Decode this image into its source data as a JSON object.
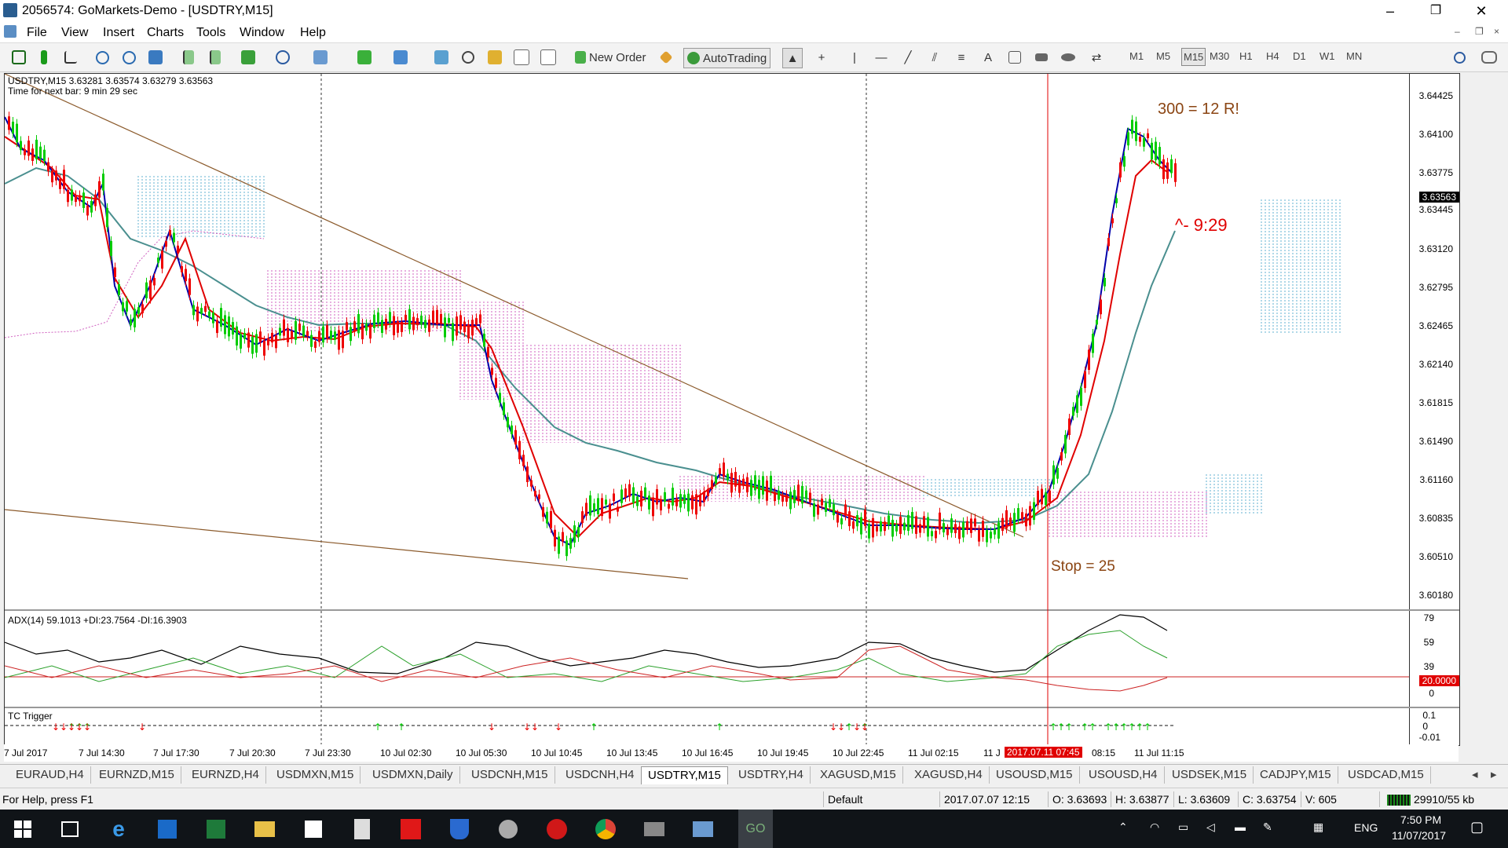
{
  "window": {
    "title": "2056574: GoMarkets-Demo - [USDTRY,M15]",
    "minimize_glyph": "–",
    "maximize_glyph": "❐",
    "close_glyph": "✕"
  },
  "menu": {
    "items": [
      "File",
      "View",
      "Insert",
      "Charts",
      "Tools",
      "Window",
      "Help"
    ],
    "child_controls": [
      "–",
      "❐",
      "×"
    ]
  },
  "toolbar": {
    "new_order_label": "New Order",
    "autotrading_label": "AutoTrading",
    "timeframes": [
      "M1",
      "M5",
      "M15",
      "M30",
      "H1",
      "H4",
      "D1",
      "W1",
      "MN"
    ],
    "active_timeframe": "M15",
    "text_tool_glyph": "A"
  },
  "chart": {
    "header_line": "USDTRY,M15  3.63281 3.63574 3.63279 3.63563",
    "timer_line": "Time for next bar: 9 min 29 sec",
    "annotation_target": "300 = 12 R!",
    "annotation_timer": "^- 9:29",
    "annotation_stop": "Stop = 25",
    "price_labels": [
      "3.64425",
      "3.64100",
      "3.63775",
      "3.63563",
      "3.63445",
      "3.63120",
      "3.62795",
      "3.62465",
      "3.62140",
      "3.61815",
      "3.61490",
      "3.61160",
      "3.60835",
      "3.60510",
      "3.60180"
    ],
    "current_price": "3.63563",
    "colors": {
      "bull": "#00cc00",
      "bear": "#ee0000",
      "fast_ma": "#0000aa",
      "mid_ma": "#e00000",
      "slow_ma": "#4a8f8f",
      "cloud_pink": "#d060c0",
      "cloud_blue": "#60b0d0",
      "trendline": "#8b5a2b",
      "adx_line": "#000000",
      "plus_di": "#2aa02a",
      "minus_di": "#cc2222"
    }
  },
  "adx": {
    "label": "ADX(14) 59.1013 +DI:23.7564 -DI:16.3903",
    "axis_labels": [
      "79",
      "59",
      "39",
      "20.0000",
      "0"
    ],
    "level_label": "20.0000"
  },
  "tc": {
    "label": "TC Trigger",
    "axis_labels": [
      "0.1",
      "0",
      "-0.01"
    ],
    "axis_top_label": "0.1"
  },
  "time_axis": {
    "labels": [
      "7 Jul 2017",
      "7 Jul 14:30",
      "7 Jul 17:30",
      "7 Jul 20:30",
      "7 Jul 23:30",
      "10 Jul 02:30",
      "10 Jul 05:30",
      "10 Jul 10:45",
      "10 Jul 13:45",
      "10 Jul 16:45",
      "10 Jul 19:45",
      "10 Jul 22:45",
      "11 Jul 02:15",
      "11 J",
      "08:15",
      "11 Jul 11:15"
    ],
    "highlight": "2017.07.11 07:45"
  },
  "tabs": {
    "items": [
      "EURAUD,H4",
      "EURNZD,M15",
      "EURNZD,H4",
      "USDMXN,M15",
      "USDMXN,Daily",
      "USDCNH,M15",
      "USDCNH,H4",
      "USDTRY,M15",
      "USDTRY,H4",
      "XAGUSD,M15",
      "XAGUSD,H4",
      "USOUSD,M15",
      "USOUSD,H4",
      "USDSEK,M15",
      "CADJPY,M15",
      "USDCAD,M15"
    ],
    "active": "USDTRY,M15",
    "prev_glyph": "◂",
    "next_glyph": "▸"
  },
  "status": {
    "help": "For Help, press F1",
    "profile": "Default",
    "datetime": "2017.07.07 12:15",
    "open": "O: 3.63693",
    "high": "H: 3.63877",
    "low": "L: 3.63609",
    "close": "C: 3.63754",
    "volume": "V: 605",
    "traffic": "29910/55 kb"
  },
  "taskbar": {
    "language": "ENG",
    "time": "7:50 PM",
    "date": "11/07/2017"
  }
}
